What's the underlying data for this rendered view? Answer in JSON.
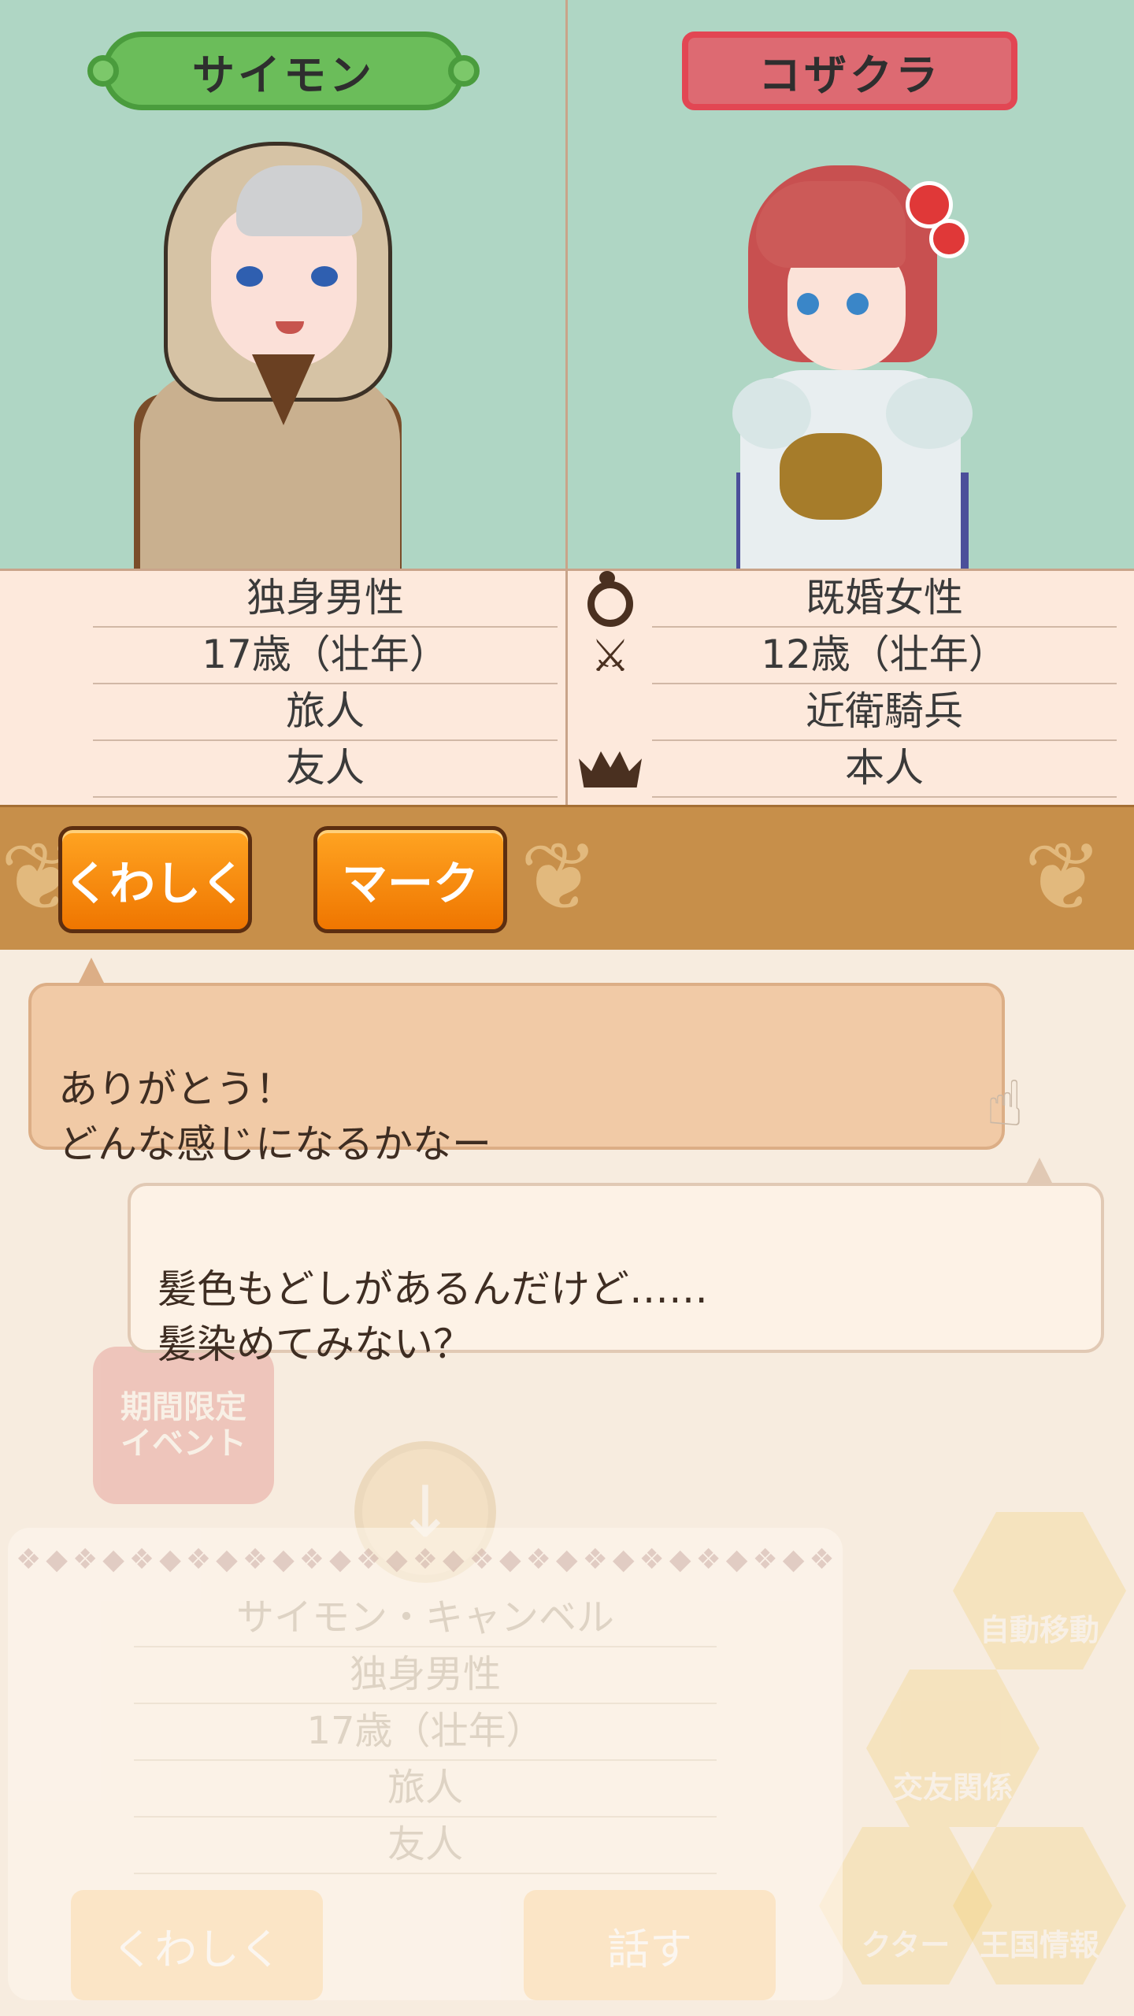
{
  "left_character": {
    "name": "サイモン",
    "status": "独身男性",
    "age": "17歳（壮年）",
    "occupation": "旅人",
    "relation": "友人"
  },
  "right_character": {
    "name": "コザクラ",
    "status": "既婚女性",
    "age": "12歳（壮年）",
    "occupation": "近衛騎兵",
    "relation": "本人"
  },
  "info_icons": [
    "ring-icon",
    "crossed-swords-icon",
    "crown-icon"
  ],
  "actions": {
    "details_label": "くわしく",
    "mark_label": "マーク"
  },
  "dialogue": [
    {
      "text": "ありがとう！\nどんな感じになるかなー"
    },
    {
      "text": "髪色もどしがあるんだけど……\n髪染めてみない？"
    }
  ],
  "background": {
    "event_badge": "期間限定\nイベント",
    "hex_buttons": [
      "自動移動",
      "交友関係",
      "王国情報",
      "クター"
    ],
    "card": {
      "name": "サイモン・キャンベル",
      "status": "独身男性",
      "age": "17歳（壮年）",
      "occupation": "旅人",
      "relation": "友人",
      "details_label": "くわしく",
      "talk_label": "話す"
    }
  },
  "colors": {
    "portrait_bg": "#afd6c4",
    "info_bg": "#fde9dc",
    "action_bar": "#c78f4a",
    "button_orange": "#ef7600",
    "name_tag_green": "#6bbd5a",
    "name_tag_red": "#dd6a72"
  }
}
